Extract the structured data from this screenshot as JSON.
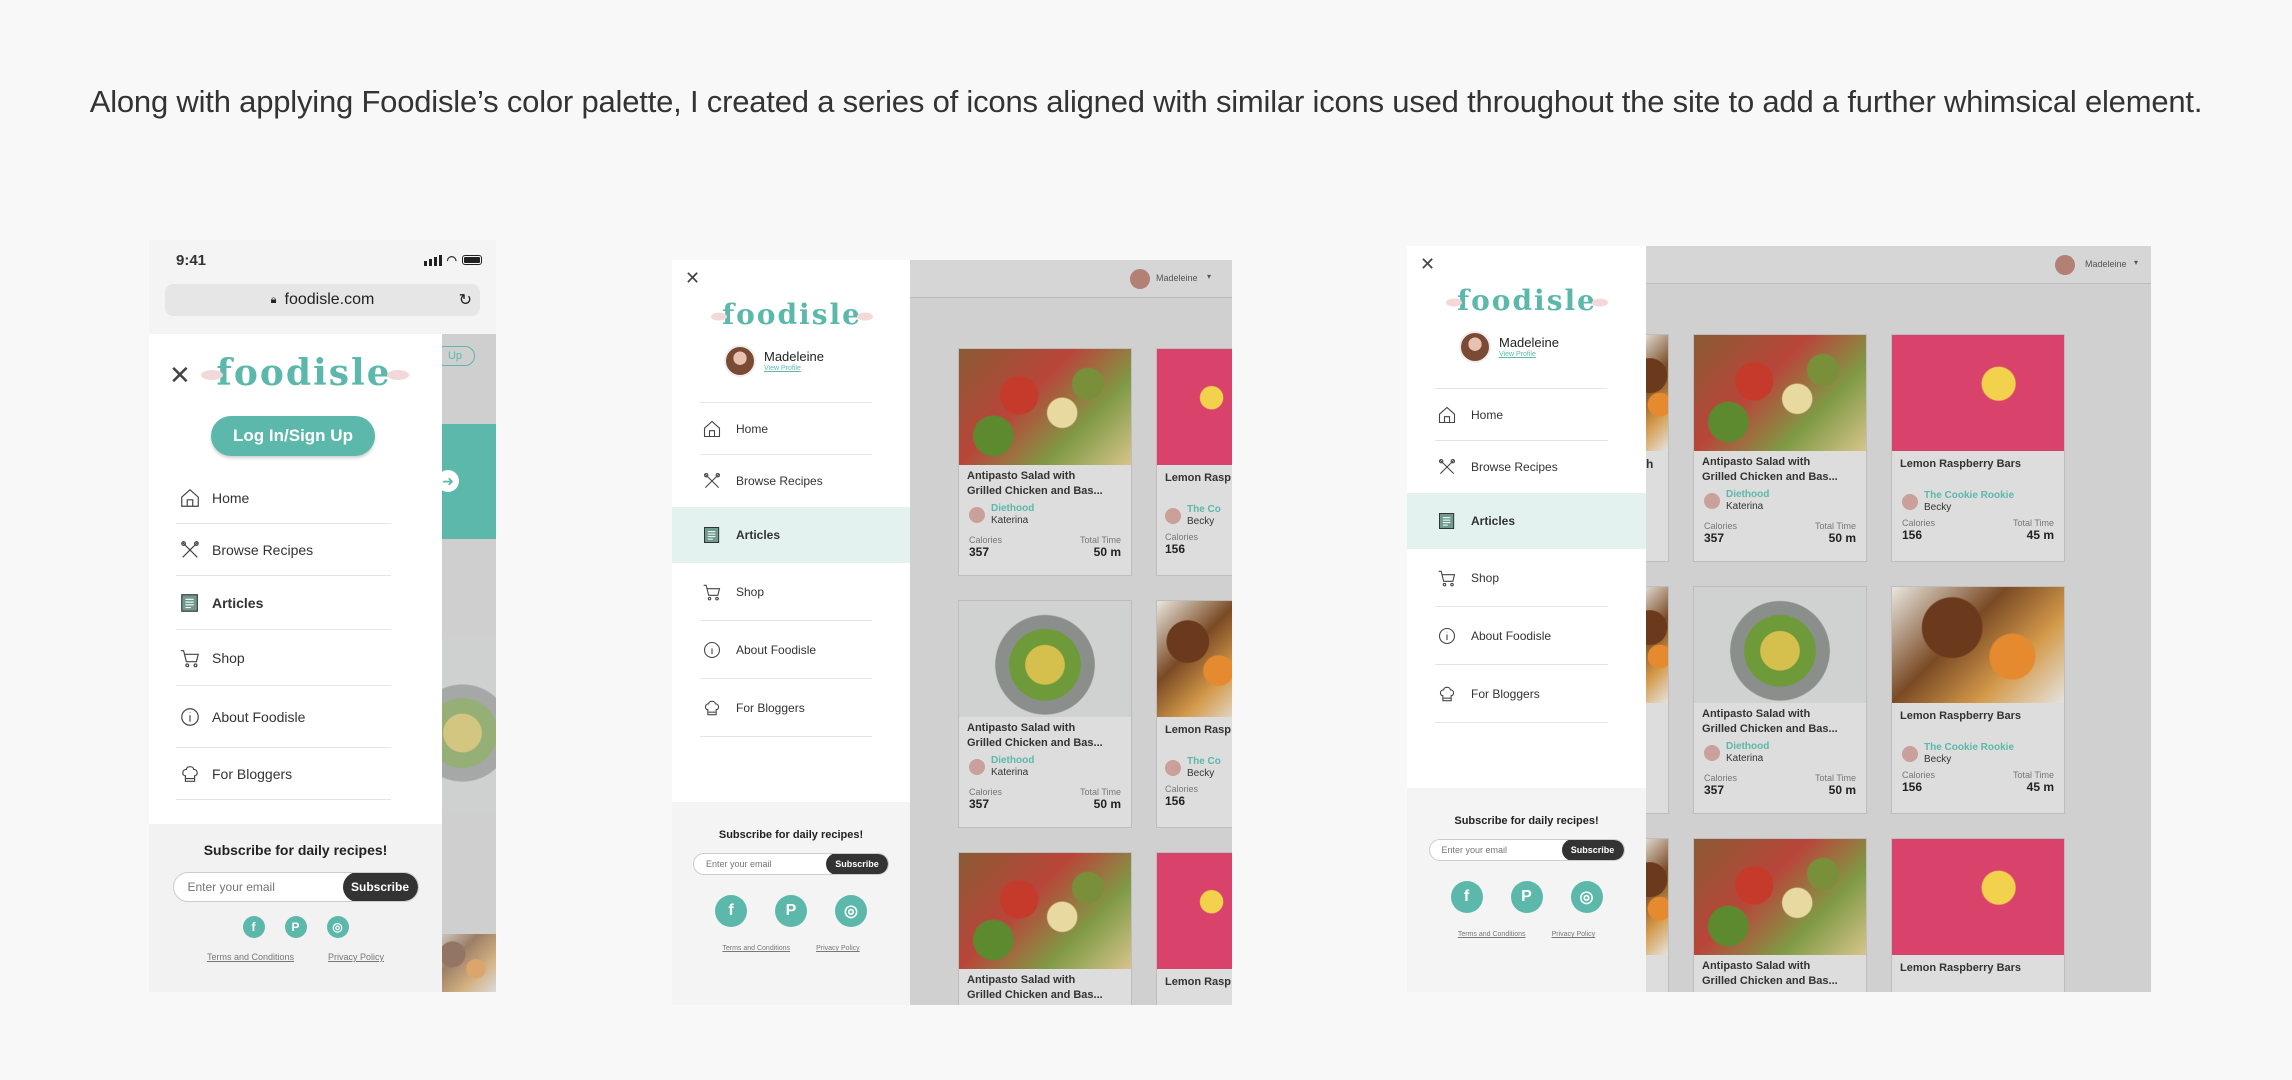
{
  "caption": "Along with applying Foodisle’s color palette, I created a series of icons aligned with similar icons used throughout the site to add a further whimsical element.",
  "brand": {
    "logo": "foodisle",
    "accent": "#5bb8ab"
  },
  "mobile": {
    "status_time": "9:41",
    "url": "foodisle.com",
    "login_label": "Log In/Sign Up",
    "header_peek": "Up"
  },
  "user": {
    "name": "Madeleine",
    "view_profile": "View Profile"
  },
  "nav": [
    {
      "label": "Home",
      "icon": "home-icon"
    },
    {
      "label": "Browse Recipes",
      "icon": "utensils-icon"
    },
    {
      "label": "Articles",
      "icon": "book-icon"
    },
    {
      "label": "Shop",
      "icon": "cart-icon"
    },
    {
      "label": "About Foodisle",
      "icon": "info-icon"
    },
    {
      "label": "For Bloggers",
      "icon": "chef-hat-icon"
    }
  ],
  "subscribe": {
    "title": "Subscribe for daily recipes!",
    "placeholder": "Enter your email",
    "button": "Subscribe"
  },
  "socials": [
    "facebook-icon",
    "pinterest-icon",
    "instagram-icon"
  ],
  "legal": {
    "terms": "Terms and Conditions",
    "privacy": "Privacy Policy"
  },
  "cards": {
    "salad": {
      "title_l1": "Antipasto Salad with",
      "title_l2": "Grilled Chicken and Bas...",
      "blog": "Diethood",
      "author": "Katerina",
      "cal_label": "Calories",
      "cal": "357",
      "time_label": "Total Time",
      "time": "50 m"
    },
    "bars": {
      "title": "Lemon Raspberry Bars",
      "title_cut": "Lemon Rasp",
      "blog": "The Cookie Rookie",
      "blog_cut": "The Co",
      "author": "Becky",
      "cal_label": "Calories",
      "cal": "156",
      "time_label": "Total Time",
      "time": "45 m"
    },
    "snippets": {
      "th": "th",
      "m": "m"
    }
  }
}
